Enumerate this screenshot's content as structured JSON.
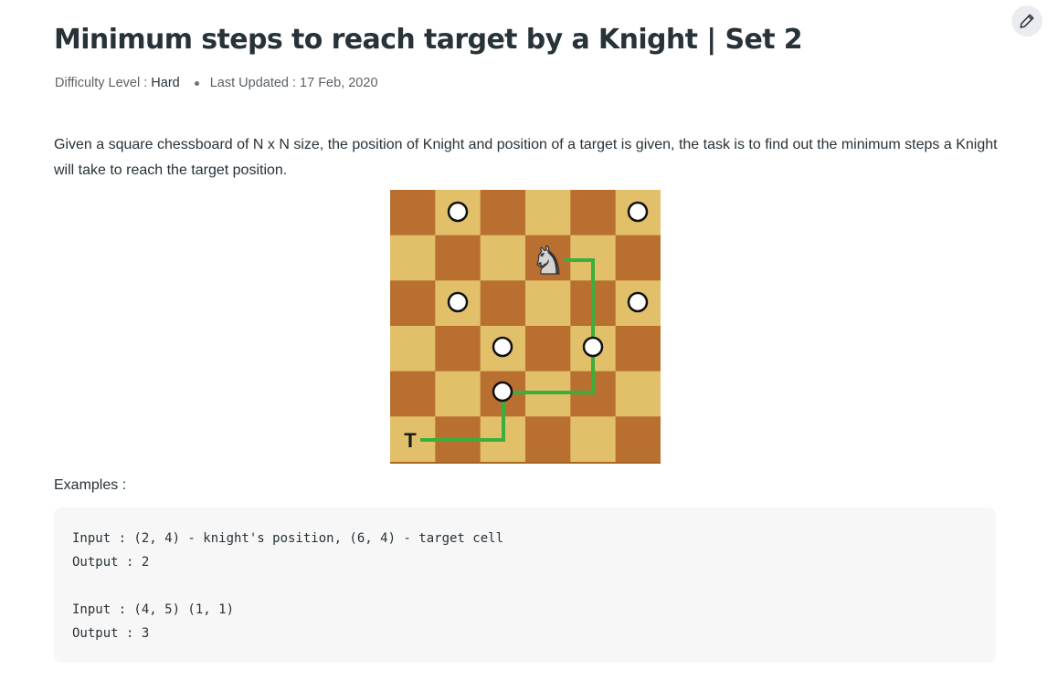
{
  "article": {
    "title": "Minimum steps to reach target by a Knight | Set 2",
    "difficulty_label": "Difficulty Level :",
    "difficulty_value": "Hard",
    "updated_label": "Last Updated :",
    "updated_value": "17 Feb, 2020",
    "description": "Given a square chessboard of N x N size, the position of Knight and position of a target is given, the task is to find out the minimum steps a Knight will take to reach the target position.",
    "examples_label": "Examples :",
    "code_lines": [
      "Input : (2, 4) - knight's position, (6, 4) - target cell",
      "Output : 2",
      "",
      "Input : (4, 5) (1, 1)",
      "Output : 3"
    ]
  },
  "board": {
    "target_label": "T",
    "knight_glyph": "♞",
    "colors": {
      "dark": "#b86f30",
      "light": "#e2c06a",
      "path": "#3cae3c"
    }
  },
  "icons": {
    "edit": "pencil-icon"
  }
}
